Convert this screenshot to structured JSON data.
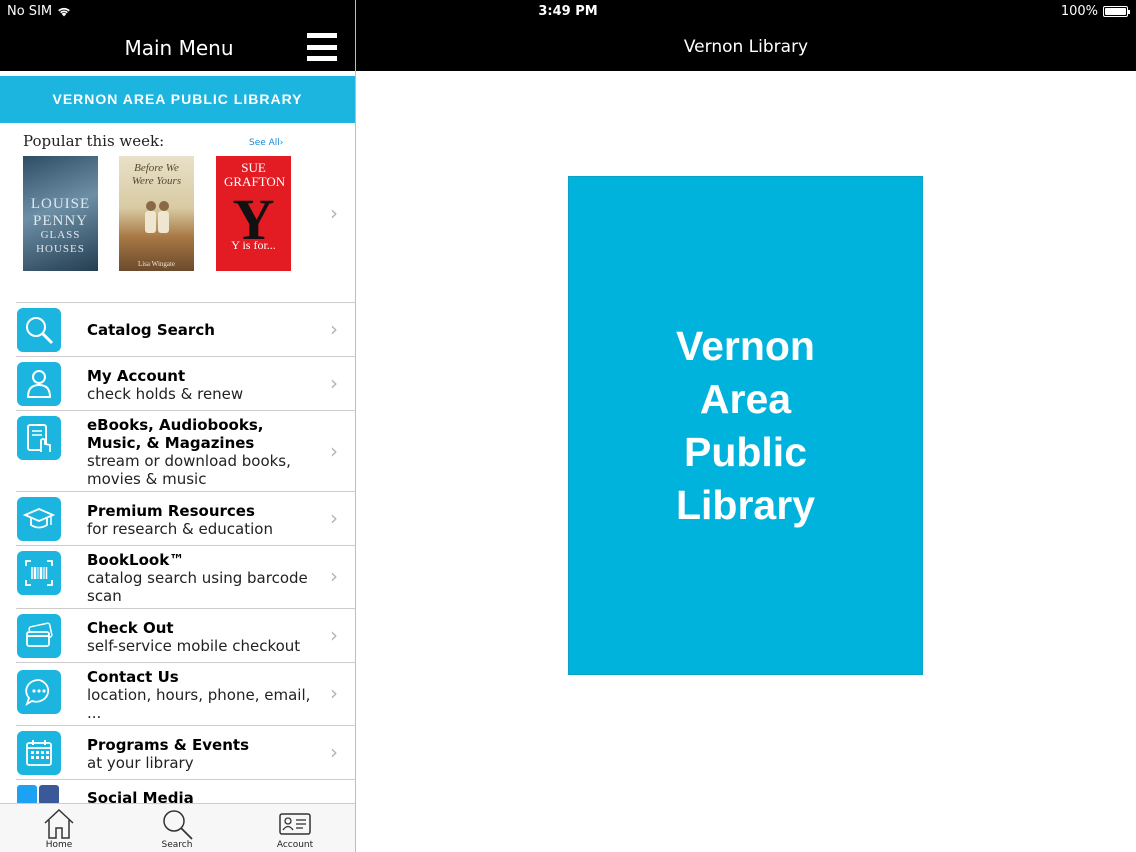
{
  "status": {
    "carrier": "No SIM",
    "time": "3:49 PM",
    "battery": "100%"
  },
  "left_nav": {
    "title": "Main Menu"
  },
  "banner": "VERNON AREA PUBLIC LIBRARY",
  "popular": {
    "title": "Popular this week:",
    "see_all": "See All›",
    "books": [
      {
        "author": "LOUISE PENNY",
        "title": "GLASS HOUSES"
      },
      {
        "title": "Before We Were Yours",
        "author": "Lisa Wingate"
      },
      {
        "author": "SUE GRAFTON",
        "title": "Y is for..."
      }
    ]
  },
  "menu": [
    {
      "title": "Catalog Search",
      "sub": ""
    },
    {
      "title": "My Account",
      "sub": "check holds & renew"
    },
    {
      "title": "eBooks, Audiobooks, Music, & Magazines",
      "sub": "stream or download books, movies & music"
    },
    {
      "title": "Premium Resources",
      "sub": "for research & education"
    },
    {
      "title": "BookLook™",
      "sub": "catalog search using barcode scan"
    },
    {
      "title": "Check Out",
      "sub": "self-service mobile checkout"
    },
    {
      "title": "Contact Us",
      "sub": "location, hours, phone, email, ..."
    },
    {
      "title": "Programs & Events",
      "sub": "at your library"
    },
    {
      "title": "Social Media",
      "sub": ""
    }
  ],
  "tabs": [
    {
      "label": "Home"
    },
    {
      "label": "Search"
    },
    {
      "label": "Account"
    }
  ],
  "right_nav": {
    "title": "Vernon Library"
  },
  "poster": {
    "line1": "Vernon",
    "line2": "Area",
    "line3": "Public",
    "line4": "Library"
  },
  "colors": {
    "accent": "#1cb5e0",
    "nav": "#000000"
  }
}
